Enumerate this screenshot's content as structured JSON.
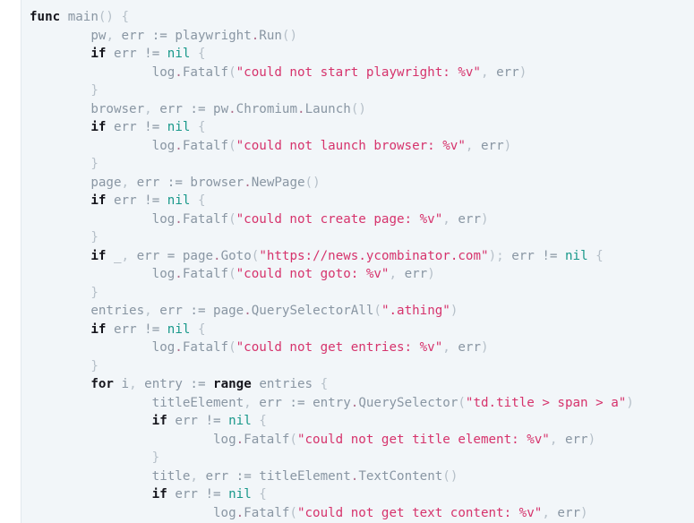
{
  "window": {
    "title": "Go source code snippet",
    "language": "go",
    "background_color": "#f2f6f9",
    "gutter_color": "#ffffff"
  },
  "theme": {
    "keyword_color": "#16161d",
    "identifier_color": "#8996a3",
    "string_color": "#d6336c",
    "nil_color": "#18988a",
    "punctuation_color": "#b6c0c9",
    "dot_color": "#b06c8a",
    "font_size_px": 14.2,
    "line_height_px": 20.5
  },
  "code": {
    "lines": [
      {
        "indent": 0,
        "tokens": [
          {
            "t": "kw",
            "v": "func"
          },
          {
            "t": "punct",
            "v": " "
          },
          {
            "t": "ident",
            "v": "main"
          },
          {
            "t": "punct",
            "v": "() {"
          }
        ]
      },
      {
        "indent": 1,
        "tokens": [
          {
            "t": "ident",
            "v": "pw"
          },
          {
            "t": "punct",
            "v": ", "
          },
          {
            "t": "ident",
            "v": "err"
          },
          {
            "t": "op",
            "v": " := "
          },
          {
            "t": "ident",
            "v": "playwright"
          },
          {
            "t": "dot",
            "v": "."
          },
          {
            "t": "prop",
            "v": "Run"
          },
          {
            "t": "punct",
            "v": "()"
          }
        ]
      },
      {
        "indent": 1,
        "tokens": [
          {
            "t": "kw",
            "v": "if"
          },
          {
            "t": "punct",
            "v": " "
          },
          {
            "t": "ident",
            "v": "err"
          },
          {
            "t": "op",
            "v": " != "
          },
          {
            "t": "nil",
            "v": "nil"
          },
          {
            "t": "punct",
            "v": " {"
          }
        ]
      },
      {
        "indent": 2,
        "tokens": [
          {
            "t": "ident",
            "v": "log"
          },
          {
            "t": "dot",
            "v": "."
          },
          {
            "t": "prop",
            "v": "Fatalf"
          },
          {
            "t": "punct",
            "v": "("
          },
          {
            "t": "str",
            "v": "\"could not start playwright: %v\""
          },
          {
            "t": "punct",
            "v": ", "
          },
          {
            "t": "ident",
            "v": "err"
          },
          {
            "t": "punct",
            "v": ")"
          }
        ]
      },
      {
        "indent": 1,
        "tokens": [
          {
            "t": "punct",
            "v": "}"
          }
        ]
      },
      {
        "indent": 1,
        "tokens": [
          {
            "t": "ident",
            "v": "browser"
          },
          {
            "t": "punct",
            "v": ", "
          },
          {
            "t": "ident",
            "v": "err"
          },
          {
            "t": "op",
            "v": " := "
          },
          {
            "t": "ident",
            "v": "pw"
          },
          {
            "t": "dot",
            "v": "."
          },
          {
            "t": "prop",
            "v": "Chromium"
          },
          {
            "t": "dot",
            "v": "."
          },
          {
            "t": "prop",
            "v": "Launch"
          },
          {
            "t": "punct",
            "v": "()"
          }
        ]
      },
      {
        "indent": 1,
        "tokens": [
          {
            "t": "kw",
            "v": "if"
          },
          {
            "t": "punct",
            "v": " "
          },
          {
            "t": "ident",
            "v": "err"
          },
          {
            "t": "op",
            "v": " != "
          },
          {
            "t": "nil",
            "v": "nil"
          },
          {
            "t": "punct",
            "v": " {"
          }
        ]
      },
      {
        "indent": 2,
        "tokens": [
          {
            "t": "ident",
            "v": "log"
          },
          {
            "t": "dot",
            "v": "."
          },
          {
            "t": "prop",
            "v": "Fatalf"
          },
          {
            "t": "punct",
            "v": "("
          },
          {
            "t": "str",
            "v": "\"could not launch browser: %v\""
          },
          {
            "t": "punct",
            "v": ", "
          },
          {
            "t": "ident",
            "v": "err"
          },
          {
            "t": "punct",
            "v": ")"
          }
        ]
      },
      {
        "indent": 1,
        "tokens": [
          {
            "t": "punct",
            "v": "}"
          }
        ]
      },
      {
        "indent": 1,
        "tokens": [
          {
            "t": "ident",
            "v": "page"
          },
          {
            "t": "punct",
            "v": ", "
          },
          {
            "t": "ident",
            "v": "err"
          },
          {
            "t": "op",
            "v": " := "
          },
          {
            "t": "ident",
            "v": "browser"
          },
          {
            "t": "dot",
            "v": "."
          },
          {
            "t": "prop",
            "v": "NewPage"
          },
          {
            "t": "punct",
            "v": "()"
          }
        ]
      },
      {
        "indent": 1,
        "tokens": [
          {
            "t": "kw",
            "v": "if"
          },
          {
            "t": "punct",
            "v": " "
          },
          {
            "t": "ident",
            "v": "err"
          },
          {
            "t": "op",
            "v": " != "
          },
          {
            "t": "nil",
            "v": "nil"
          },
          {
            "t": "punct",
            "v": " {"
          }
        ]
      },
      {
        "indent": 2,
        "tokens": [
          {
            "t": "ident",
            "v": "log"
          },
          {
            "t": "dot",
            "v": "."
          },
          {
            "t": "prop",
            "v": "Fatalf"
          },
          {
            "t": "punct",
            "v": "("
          },
          {
            "t": "str",
            "v": "\"could not create page: %v\""
          },
          {
            "t": "punct",
            "v": ", "
          },
          {
            "t": "ident",
            "v": "err"
          },
          {
            "t": "punct",
            "v": ")"
          }
        ]
      },
      {
        "indent": 1,
        "tokens": [
          {
            "t": "punct",
            "v": "}"
          }
        ]
      },
      {
        "indent": 1,
        "tokens": [
          {
            "t": "kw",
            "v": "if"
          },
          {
            "t": "punct",
            "v": " "
          },
          {
            "t": "ident",
            "v": "_"
          },
          {
            "t": "punct",
            "v": ", "
          },
          {
            "t": "ident",
            "v": "err"
          },
          {
            "t": "op",
            "v": " = "
          },
          {
            "t": "ident",
            "v": "page"
          },
          {
            "t": "dot",
            "v": "."
          },
          {
            "t": "prop",
            "v": "Goto"
          },
          {
            "t": "punct",
            "v": "("
          },
          {
            "t": "str",
            "v": "\"https://news.ycombinator.com\""
          },
          {
            "t": "punct",
            "v": "); "
          },
          {
            "t": "ident",
            "v": "err"
          },
          {
            "t": "op",
            "v": " != "
          },
          {
            "t": "nil",
            "v": "nil"
          },
          {
            "t": "punct",
            "v": " {"
          }
        ]
      },
      {
        "indent": 2,
        "tokens": [
          {
            "t": "ident",
            "v": "log"
          },
          {
            "t": "dot",
            "v": "."
          },
          {
            "t": "prop",
            "v": "Fatalf"
          },
          {
            "t": "punct",
            "v": "("
          },
          {
            "t": "str",
            "v": "\"could not goto: %v\""
          },
          {
            "t": "punct",
            "v": ", "
          },
          {
            "t": "ident",
            "v": "err"
          },
          {
            "t": "punct",
            "v": ")"
          }
        ]
      },
      {
        "indent": 1,
        "tokens": [
          {
            "t": "punct",
            "v": "}"
          }
        ]
      },
      {
        "indent": 1,
        "tokens": [
          {
            "t": "ident",
            "v": "entries"
          },
          {
            "t": "punct",
            "v": ", "
          },
          {
            "t": "ident",
            "v": "err"
          },
          {
            "t": "op",
            "v": " := "
          },
          {
            "t": "ident",
            "v": "page"
          },
          {
            "t": "dot",
            "v": "."
          },
          {
            "t": "prop",
            "v": "QuerySelectorAll"
          },
          {
            "t": "punct",
            "v": "("
          },
          {
            "t": "str",
            "v": "\".athing\""
          },
          {
            "t": "punct",
            "v": ")"
          }
        ]
      },
      {
        "indent": 1,
        "tokens": [
          {
            "t": "kw",
            "v": "if"
          },
          {
            "t": "punct",
            "v": " "
          },
          {
            "t": "ident",
            "v": "err"
          },
          {
            "t": "op",
            "v": " != "
          },
          {
            "t": "nil",
            "v": "nil"
          },
          {
            "t": "punct",
            "v": " {"
          }
        ]
      },
      {
        "indent": 2,
        "tokens": [
          {
            "t": "ident",
            "v": "log"
          },
          {
            "t": "dot",
            "v": "."
          },
          {
            "t": "prop",
            "v": "Fatalf"
          },
          {
            "t": "punct",
            "v": "("
          },
          {
            "t": "str",
            "v": "\"could not get entries: %v\""
          },
          {
            "t": "punct",
            "v": ", "
          },
          {
            "t": "ident",
            "v": "err"
          },
          {
            "t": "punct",
            "v": ")"
          }
        ]
      },
      {
        "indent": 1,
        "tokens": [
          {
            "t": "punct",
            "v": "}"
          }
        ]
      },
      {
        "indent": 1,
        "tokens": [
          {
            "t": "kw",
            "v": "for"
          },
          {
            "t": "punct",
            "v": " "
          },
          {
            "t": "ident",
            "v": "i"
          },
          {
            "t": "punct",
            "v": ", "
          },
          {
            "t": "ident",
            "v": "entry"
          },
          {
            "t": "op",
            "v": " := "
          },
          {
            "t": "kw",
            "v": "range"
          },
          {
            "t": "punct",
            "v": " "
          },
          {
            "t": "ident",
            "v": "entries"
          },
          {
            "t": "punct",
            "v": " {"
          }
        ]
      },
      {
        "indent": 2,
        "tokens": [
          {
            "t": "ident",
            "v": "titleElement"
          },
          {
            "t": "punct",
            "v": ", "
          },
          {
            "t": "ident",
            "v": "err"
          },
          {
            "t": "op",
            "v": " := "
          },
          {
            "t": "ident",
            "v": "entry"
          },
          {
            "t": "dot",
            "v": "."
          },
          {
            "t": "prop",
            "v": "QuerySelector"
          },
          {
            "t": "punct",
            "v": "("
          },
          {
            "t": "str",
            "v": "\"td.title > span > a\""
          },
          {
            "t": "punct",
            "v": ")"
          }
        ]
      },
      {
        "indent": 2,
        "tokens": [
          {
            "t": "kw",
            "v": "if"
          },
          {
            "t": "punct",
            "v": " "
          },
          {
            "t": "ident",
            "v": "err"
          },
          {
            "t": "op",
            "v": " != "
          },
          {
            "t": "nil",
            "v": "nil"
          },
          {
            "t": "punct",
            "v": " {"
          }
        ]
      },
      {
        "indent": 3,
        "tokens": [
          {
            "t": "ident",
            "v": "log"
          },
          {
            "t": "dot",
            "v": "."
          },
          {
            "t": "prop",
            "v": "Fatalf"
          },
          {
            "t": "punct",
            "v": "("
          },
          {
            "t": "str",
            "v": "\"could not get title element: %v\""
          },
          {
            "t": "punct",
            "v": ", "
          },
          {
            "t": "ident",
            "v": "err"
          },
          {
            "t": "punct",
            "v": ")"
          }
        ]
      },
      {
        "indent": 2,
        "tokens": [
          {
            "t": "punct",
            "v": "}"
          }
        ]
      },
      {
        "indent": 2,
        "tokens": [
          {
            "t": "ident",
            "v": "title"
          },
          {
            "t": "punct",
            "v": ", "
          },
          {
            "t": "ident",
            "v": "err"
          },
          {
            "t": "op",
            "v": " := "
          },
          {
            "t": "ident",
            "v": "titleElement"
          },
          {
            "t": "dot",
            "v": "."
          },
          {
            "t": "prop",
            "v": "TextContent"
          },
          {
            "t": "punct",
            "v": "()"
          }
        ]
      },
      {
        "indent": 2,
        "tokens": [
          {
            "t": "kw",
            "v": "if"
          },
          {
            "t": "punct",
            "v": " "
          },
          {
            "t": "ident",
            "v": "err"
          },
          {
            "t": "op",
            "v": " != "
          },
          {
            "t": "nil",
            "v": "nil"
          },
          {
            "t": "punct",
            "v": " {"
          }
        ]
      },
      {
        "indent": 3,
        "tokens": [
          {
            "t": "ident",
            "v": "log"
          },
          {
            "t": "dot",
            "v": "."
          },
          {
            "t": "prop",
            "v": "Fatalf"
          },
          {
            "t": "punct",
            "v": "("
          },
          {
            "t": "str",
            "v": "\"could not get text content: %v\""
          },
          {
            "t": "punct",
            "v": ", "
          },
          {
            "t": "ident",
            "v": "err"
          },
          {
            "t": "punct",
            "v": ")"
          }
        ]
      }
    ]
  }
}
